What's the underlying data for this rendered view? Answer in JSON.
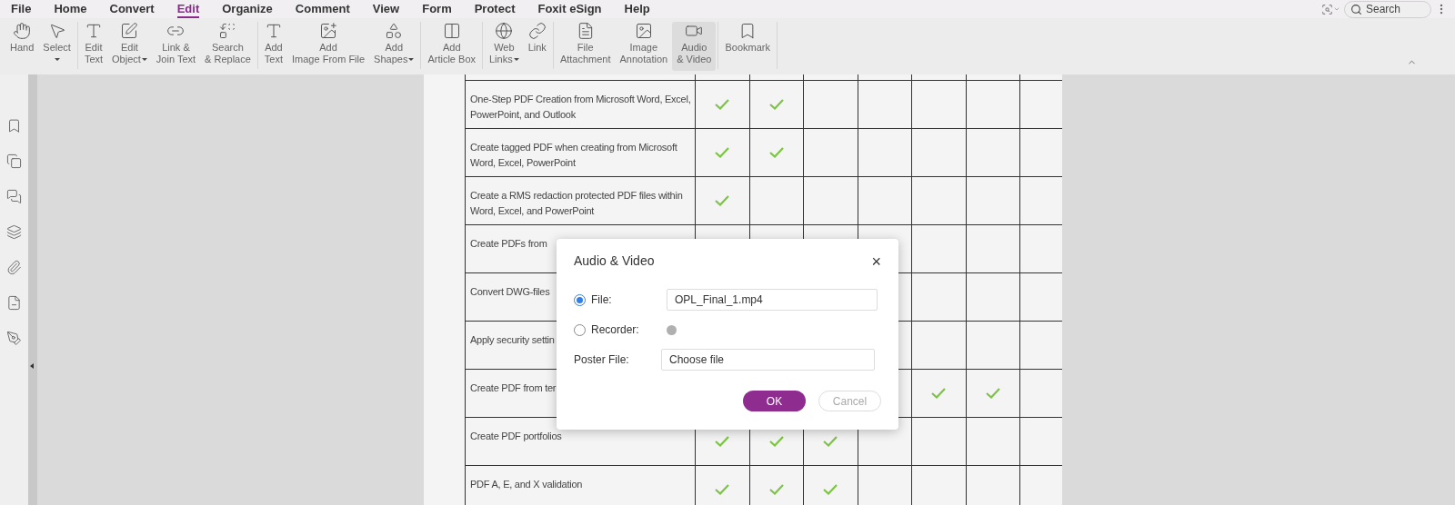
{
  "menu": [
    {
      "label": "File",
      "selected": false
    },
    {
      "label": "Home",
      "selected": false
    },
    {
      "label": "Convert",
      "selected": false
    },
    {
      "label": "Edit",
      "selected": true
    },
    {
      "label": "Organize",
      "selected": false
    },
    {
      "label": "Comment",
      "selected": false
    },
    {
      "label": "View",
      "selected": false
    },
    {
      "label": "Form",
      "selected": false
    },
    {
      "label": "Protect",
      "selected": false
    },
    {
      "label": "Foxit eSign",
      "selected": false
    },
    {
      "label": "Help",
      "selected": false
    }
  ],
  "search": {
    "placeholder": "Search"
  },
  "toolbar": [
    {
      "items": [
        {
          "kind": "hand",
          "lines": [
            "Hand"
          ],
          "dropdown": false,
          "selected": false
        },
        {
          "kind": "select",
          "lines": [
            "Select"
          ],
          "dropdown": true,
          "selected": false
        }
      ]
    },
    {
      "items": [
        {
          "kind": "edit-text",
          "lines": [
            "Edit",
            "Text"
          ],
          "dropdown": false,
          "selected": false
        },
        {
          "kind": "edit-object",
          "lines": [
            "Edit",
            "Object"
          ],
          "dropdown": true,
          "selected": false
        },
        {
          "kind": "link-join",
          "lines": [
            "Link &",
            "Join Text"
          ],
          "dropdown": false,
          "selected": false
        },
        {
          "kind": "search-replace",
          "lines": [
            "Search",
            "& Replace"
          ],
          "dropdown": false,
          "selected": false
        }
      ]
    },
    {
      "items": [
        {
          "kind": "add-text",
          "lines": [
            "Add",
            "Text"
          ],
          "dropdown": false,
          "selected": false
        },
        {
          "kind": "add-image",
          "lines": [
            "Add",
            "Image From File"
          ],
          "dropdown": false,
          "selected": false
        },
        {
          "kind": "add-shapes",
          "lines": [
            "Add",
            "Shapes"
          ],
          "dropdown": true,
          "selected": false
        }
      ]
    },
    {
      "items": [
        {
          "kind": "article",
          "lines": [
            "Add",
            "Article Box"
          ],
          "dropdown": false,
          "selected": false
        }
      ]
    },
    {
      "items": [
        {
          "kind": "web-links",
          "lines": [
            "Web",
            "Links"
          ],
          "dropdown": true,
          "selected": false
        },
        {
          "kind": "link",
          "lines": [
            "Link"
          ],
          "dropdown": false,
          "selected": false
        }
      ]
    },
    {
      "items": [
        {
          "kind": "attachment",
          "lines": [
            "File",
            "Attachment"
          ],
          "dropdown": false,
          "selected": false
        },
        {
          "kind": "image-annotation",
          "lines": [
            "Image",
            "Annotation"
          ],
          "dropdown": false,
          "selected": false
        },
        {
          "kind": "video",
          "lines": [
            "Audio",
            "& Video"
          ],
          "dropdown": false,
          "selected": true
        }
      ]
    },
    {
      "items": [
        {
          "kind": "bookmark",
          "lines": [
            "Bookmark"
          ],
          "dropdown": false,
          "selected": false
        }
      ]
    }
  ],
  "sidebar": [
    {
      "kind": "bookmark"
    },
    {
      "kind": "pages"
    },
    {
      "kind": "comments"
    },
    {
      "kind": "layers"
    },
    {
      "kind": "attachments"
    },
    {
      "kind": "form"
    },
    {
      "kind": "signature"
    }
  ],
  "table": {
    "rows": [
      {
        "feature": "One-Step PDF Creation from Microsoft Word, Excel, PowerPoint, and Outlook",
        "checks": [
          true,
          true,
          false,
          false,
          false,
          false
        ]
      },
      {
        "feature": "Create tagged PDF when creating from Microsoft Word, Excel, PowerPoint",
        "checks": [
          true,
          true,
          false,
          false,
          false,
          false
        ]
      },
      {
        "feature": "Create a RMS redaction protected PDF files within Word, Excel, and PowerPoint",
        "checks": [
          true,
          false,
          false,
          false,
          false,
          false
        ]
      },
      {
        "feature": "Create PDFs from",
        "checks": [
          false,
          false
        ]
      },
      {
        "feature": "Convert DWG-files",
        "checks": [
          false,
          false
        ]
      },
      {
        "feature": "Apply security settin",
        "checks": [
          false,
          false
        ]
      },
      {
        "feature": "Create PDF from ter",
        "checks": [
          true,
          true
        ]
      },
      {
        "feature": "Create PDF portfolios",
        "checks": [
          true,
          true,
          true,
          false,
          false,
          false
        ]
      },
      {
        "feature": "PDF A, E, and X validation",
        "checks": [
          true,
          true,
          true,
          false,
          false,
          false
        ]
      }
    ]
  },
  "dialog": {
    "title": "Audio & Video",
    "close": "×",
    "file": {
      "label": "File:",
      "selected": true,
      "value": "OPL_Final_1.mp4"
    },
    "recorder": {
      "label": "Recorder:",
      "selected": false
    },
    "poster": {
      "label": "Poster File:",
      "value": "Choose file"
    },
    "buttons": [
      {
        "label": "OK",
        "kind": "primary"
      },
      {
        "label": "Cancel",
        "kind": "secondary"
      }
    ]
  }
}
